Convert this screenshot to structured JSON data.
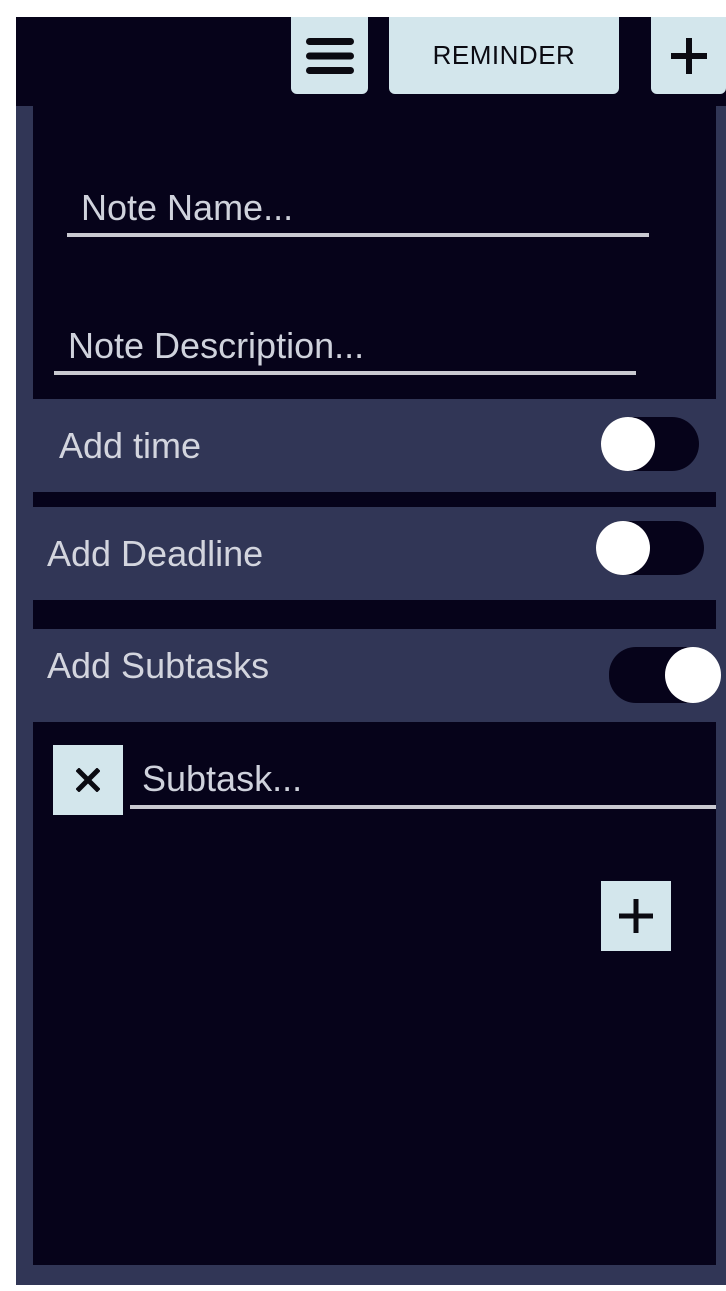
{
  "topbar": {
    "menu_icon": "hamburger-menu-icon",
    "reminder_label": "REMINDER",
    "add_icon": "plus-icon"
  },
  "note": {
    "name_placeholder": "Note Name...",
    "name_value": "",
    "description_placeholder": "Note Description...",
    "description_value": ""
  },
  "options": {
    "add_time": {
      "label": "Add time",
      "enabled": false
    },
    "add_deadline": {
      "label": "Add Deadline",
      "enabled": false
    },
    "add_subtasks": {
      "label": "Add Subtasks",
      "enabled": true
    }
  },
  "subtasks": {
    "items": [
      {
        "placeholder": "Subtask...",
        "value": "",
        "remove_icon": "close-icon"
      }
    ],
    "add_icon": "plus-icon"
  },
  "colors": {
    "background": "#313656",
    "panel": "#06031a",
    "button": "#d3e6ec",
    "text": "#d3d5de",
    "underline": "#c9c9d1"
  }
}
